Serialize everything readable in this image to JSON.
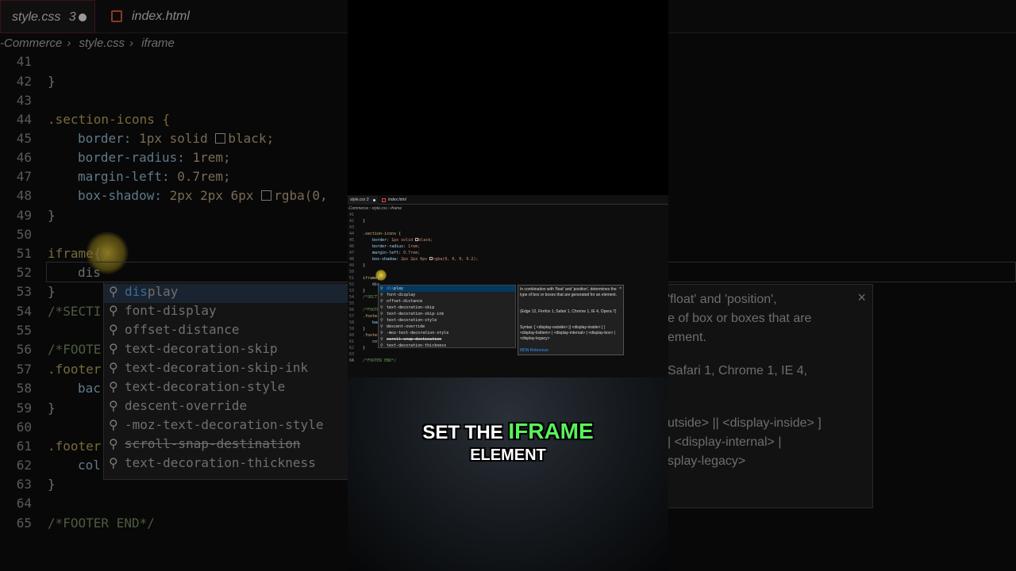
{
  "editor": {
    "tabs": [
      {
        "label": "style.css",
        "badge": "3",
        "modified": true
      },
      {
        "label": "index.html"
      }
    ],
    "breadcrumb": [
      "-Commerce",
      "style.css",
      "iframe"
    ],
    "breadcrumb_small": [
      "-Commerce",
      "style.css",
      "iframe"
    ],
    "line_numbers": [
      "41",
      "42",
      "43",
      "44",
      "45",
      "46",
      "47",
      "48",
      "49",
      "50",
      "51",
      "52",
      "53",
      "54",
      "55",
      "56",
      "57",
      "58",
      "59",
      "60",
      "61",
      "62",
      "63",
      "64",
      "65"
    ],
    "code_lines": {
      "l42": "}",
      "l44": ".section-icons {",
      "l45_prop": "border:",
      "l45_val": " 1px solid ",
      "l45_color": "black;",
      "l46_prop": "border-radius:",
      "l46_val": " 1rem;",
      "l47_prop": "margin-left:",
      "l47_val": " 0.7rem;",
      "l48_prop": "box-shadow:",
      "l48_val": " 2px 2px 6px ",
      "l48_color": "rgba(0, 0, 0, 0.2);",
      "l48_color_bg": "rgba(0,",
      "l49": "}",
      "l51": "iframe{",
      "l51_bg": "iframe{}",
      "l52": "dis",
      "l53": "}",
      "l54": "/*SECTI",
      "l54_small": "/*SECTI",
      "l56": "/*FOOTE",
      "l57": ".footer",
      "l58": "bac",
      "l59": "}",
      "l61": ".footer",
      "l62": "col",
      "l63": "}",
      "l65": "/*FOOTER END*/"
    },
    "suggestions": [
      {
        "label": "display",
        "match": "dis",
        "rest": "play"
      },
      {
        "label": "font-display",
        "pre": "font-",
        "match": "dis",
        "rest": "play"
      },
      {
        "label": "offset-distance",
        "pre": "offset-",
        "match": "dis",
        "rest": "tance"
      },
      {
        "label": "text-decoration-skip"
      },
      {
        "label": "text-decoration-skip-ink"
      },
      {
        "label": "text-decoration-style"
      },
      {
        "label": "descent-override"
      },
      {
        "label": "-moz-text-decoration-style"
      },
      {
        "label": "scroll-snap-destination"
      },
      {
        "label": "text-decoration-thickness"
      }
    ],
    "doc": {
      "text": "In combination with 'float' and 'position', determines the type of box or boxes that are generated for an element.",
      "compat": "(Edge 12, Firefox 1, Safari 1, Chrome 1, IE 4, Opera 7)",
      "syntax": "Syntax: [ <display-outside> || <display-inside> ] | <display-listitem> | <display-internal> | <display-box> | <display-legacy>",
      "link": "MDN Reference",
      "close": "×"
    },
    "doc_bg": {
      "l1": "'float' and 'position',",
      "l2": "e of box or boxes that are",
      "l3": "ement.",
      "l4": "Safari 1, Chrome 1, IE 4,",
      "l5": "utside> || <display-inside> ]",
      "l6": "| <display-internal> |",
      "l7": "splay-legacy>"
    }
  },
  "caption": {
    "pre": "SET THE ",
    "highlight": "IFRAME",
    "line2": "ELEMENT"
  },
  "colors": {
    "caption_highlight": "#5bf05b",
    "selected_item": "#04395e",
    "match_blue": "#3794ff"
  }
}
